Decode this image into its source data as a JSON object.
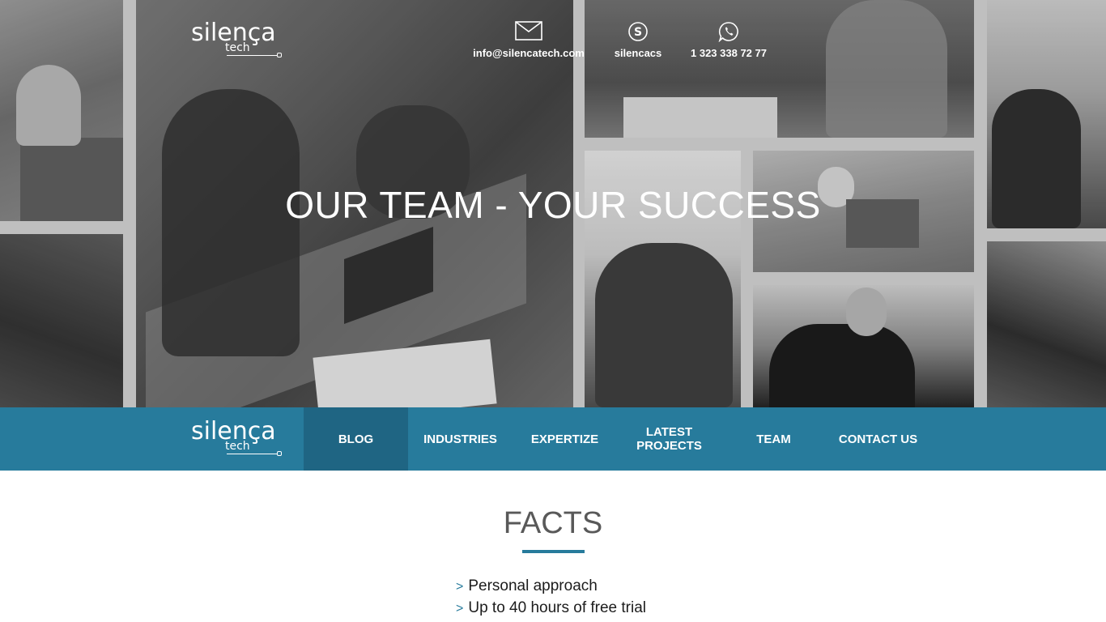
{
  "brand": {
    "logo_word": "silença",
    "logo_sub": "tech"
  },
  "contacts": {
    "email": "info@silencatech.com",
    "email_icon": "envelope-icon",
    "skype": "silencacs",
    "skype_icon": "skype-icon",
    "phone": "1 323 338 72 77",
    "phone_icon": "whatsapp-icon"
  },
  "hero": {
    "title": "OUR TEAM - YOUR SUCCESS"
  },
  "nav": {
    "items": [
      {
        "label": "BLOG",
        "active": true
      },
      {
        "label": "INDUSTRIES"
      },
      {
        "label": "EXPERTIZE"
      },
      {
        "label": "LATEST PROJECTS"
      },
      {
        "label": "TEAM"
      },
      {
        "label": "CONTACT US"
      }
    ]
  },
  "facts": {
    "title": "FACTS",
    "bullet": ">",
    "items": [
      "Personal approach",
      "Up to 40 hours of free trial"
    ]
  },
  "colors": {
    "accent": "#277b9c",
    "nav_active": "#1f6583",
    "facts_title": "#595959"
  }
}
